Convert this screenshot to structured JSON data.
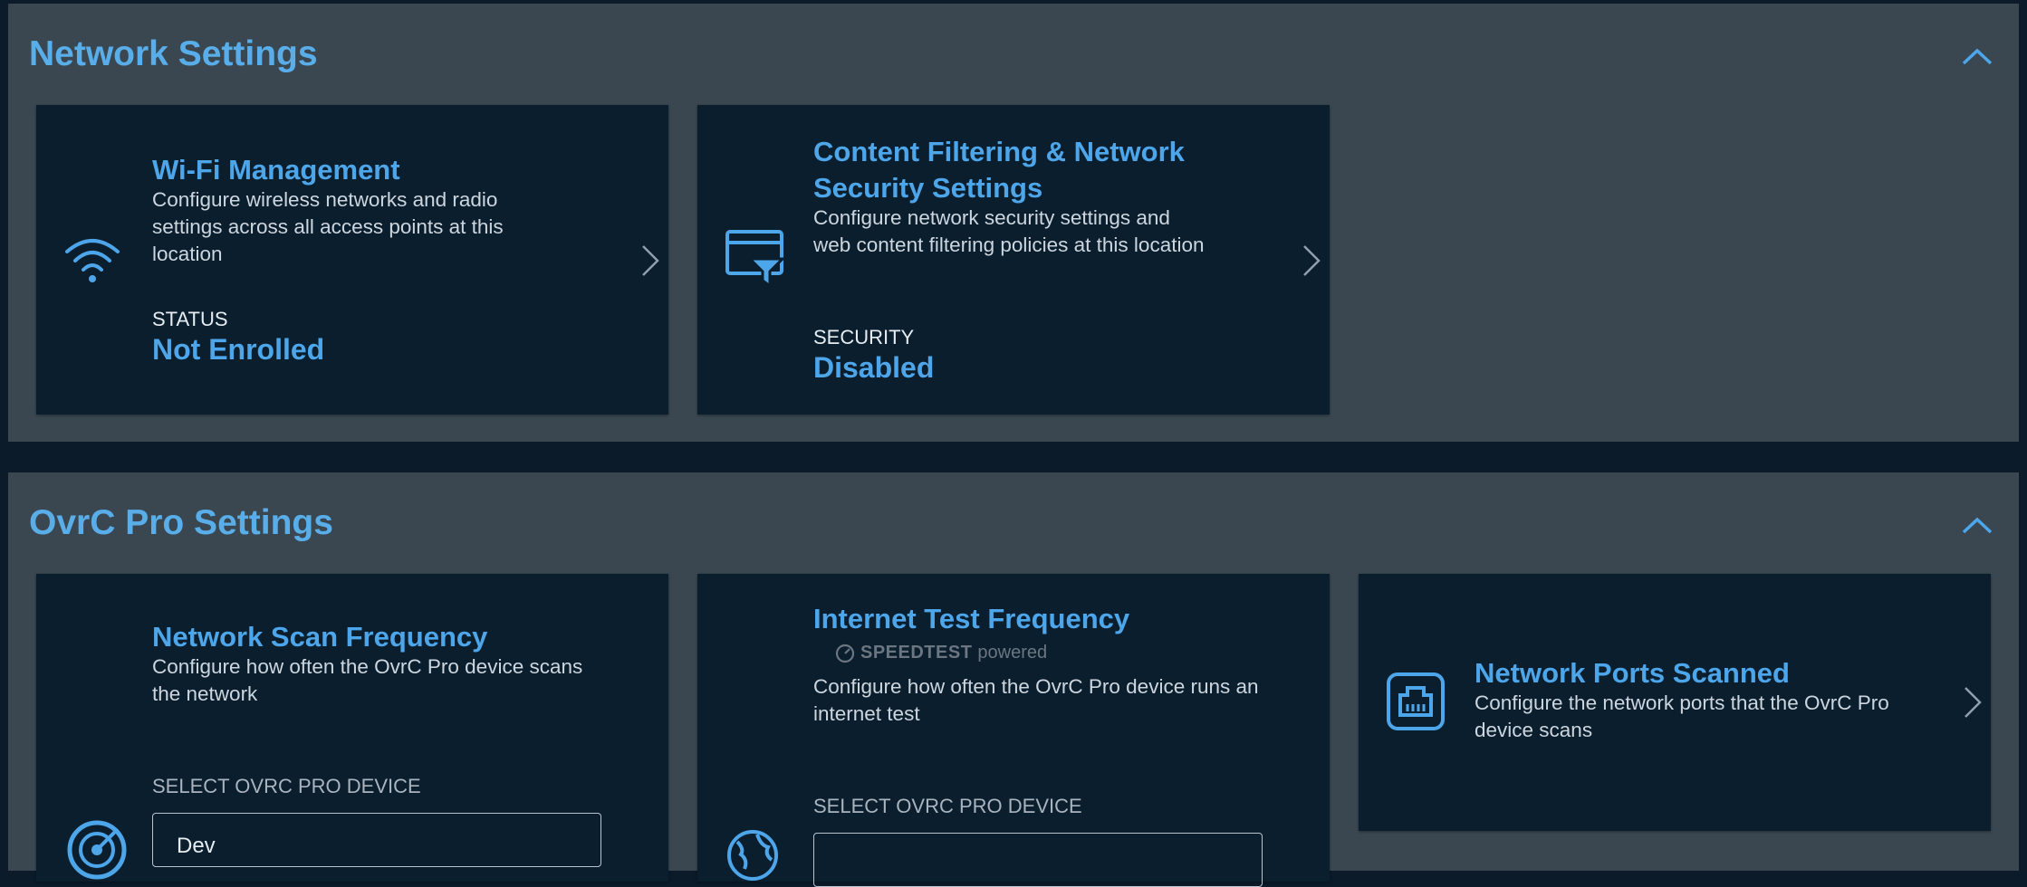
{
  "network_settings": {
    "title": "Network Settings",
    "cards": {
      "wifi": {
        "title": "Wi-Fi Management",
        "description": "Configure wireless networks and radio settings across all access points at this location",
        "status_label": "STATUS",
        "status_value": "Not Enrolled",
        "icon": "wifi-icon"
      },
      "content_filtering": {
        "title": "Content Filtering & Network Security Settings",
        "description": "Configure network security settings and web content filtering policies at this location",
        "status_label": "SECURITY",
        "status_value": "Disabled",
        "icon": "content-filter-icon"
      }
    }
  },
  "ovrc_pro_settings": {
    "title": "OvrC Pro Settings",
    "cards": {
      "scan_frequency": {
        "title": "Network Scan Frequency",
        "description": "Configure how often the OvrC Pro device scans the network",
        "select_label": "SELECT OVRC PRO DEVICE",
        "select_value": "Dev",
        "icon": "radar-icon"
      },
      "internet_test": {
        "title": "Internet Test Frequency",
        "speedtest_brand": "SPEEDTEST",
        "speedtest_suffix": "powered",
        "description": "Configure how often the OvrC Pro device runs an internet test",
        "select_label": "SELECT OVRC PRO DEVICE",
        "icon": "globe-icon"
      },
      "ports_scanned": {
        "title": "Network Ports Scanned",
        "description": "Configure the network ports that the OvrC Pro device scans",
        "icon": "ethernet-port-icon"
      }
    }
  },
  "colors": {
    "accent": "#4ea6ea",
    "page_bg": "#0b1b2a",
    "panel_bg": "#3a4750",
    "card_bg": "#0a1e2e"
  }
}
